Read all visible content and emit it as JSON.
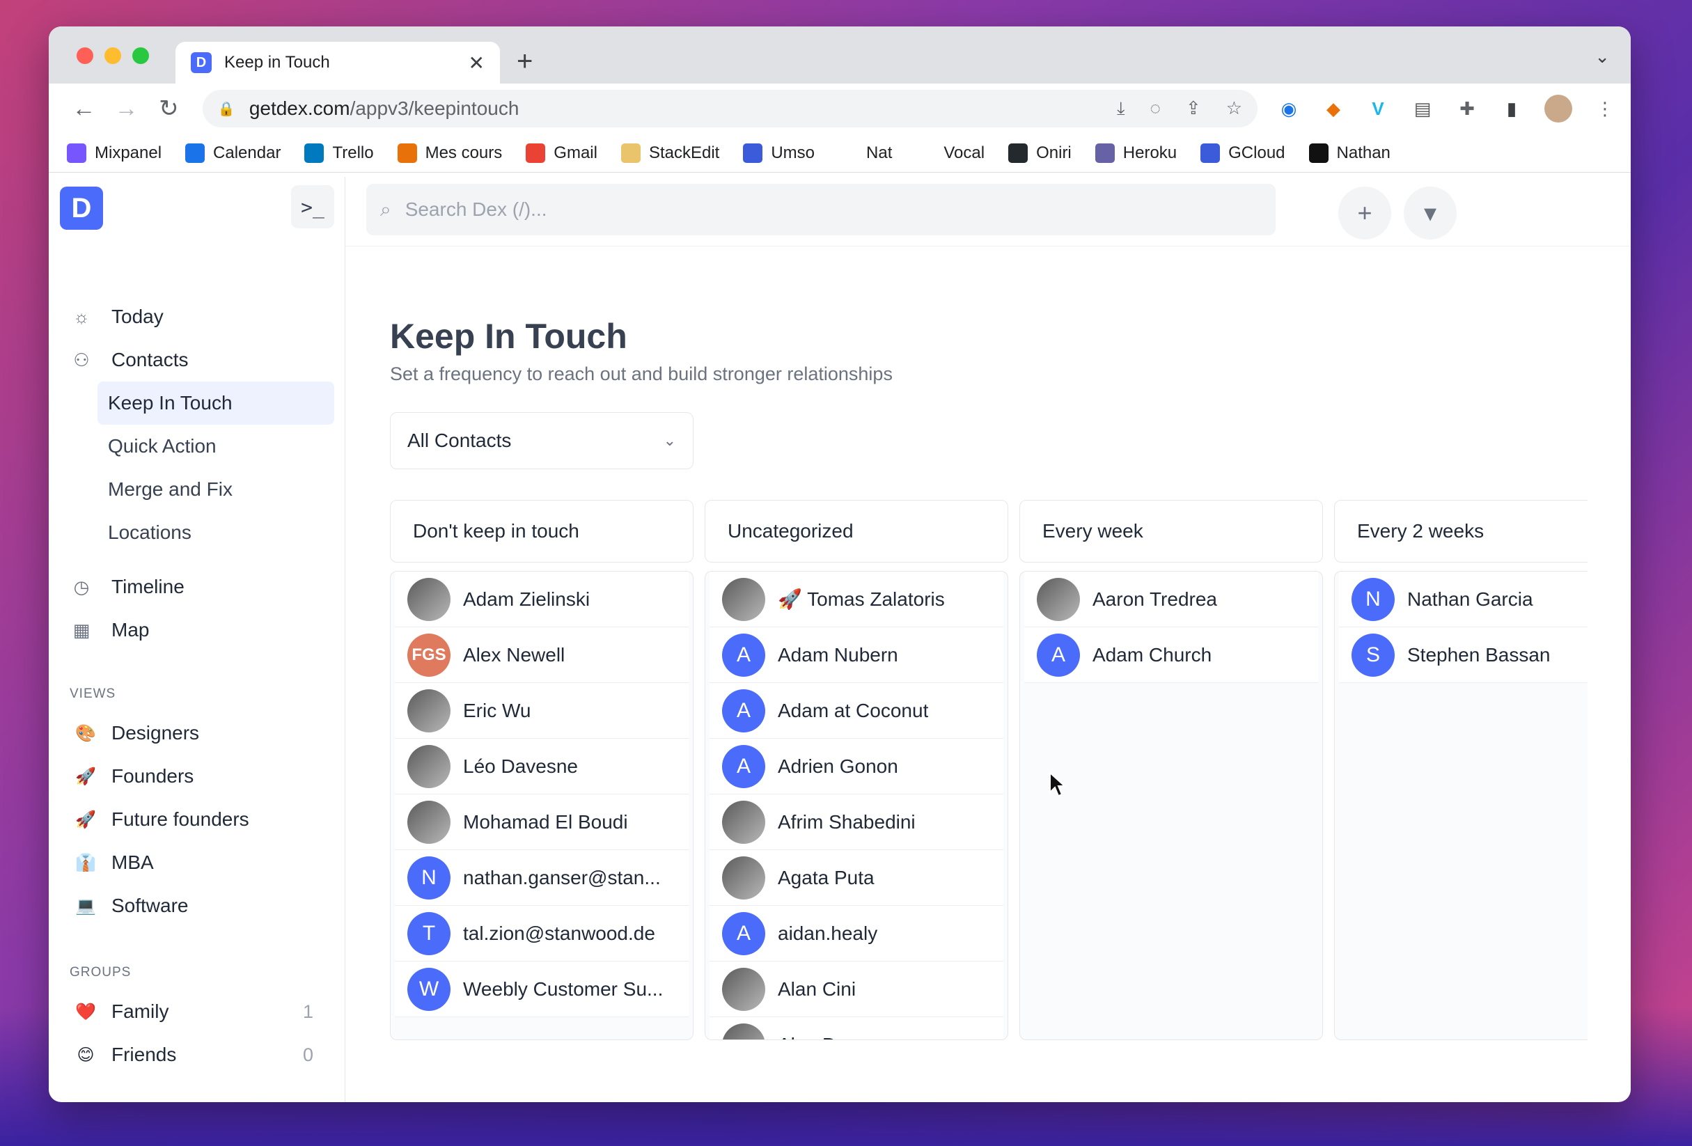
{
  "browser": {
    "tab_title": "Keep in Touch",
    "url_host": "getdex.com",
    "url_path": "/appv3/keepintouch",
    "bookmarks": [
      {
        "label": "Mixpanel",
        "color": "#7856ff"
      },
      {
        "label": "Calendar",
        "color": "#1a73e8"
      },
      {
        "label": "Trello",
        "color": "#0079bf"
      },
      {
        "label": "Mes cours",
        "color": "#e8710a"
      },
      {
        "label": "Gmail",
        "color": "#ea4335"
      },
      {
        "label": "StackEdit",
        "color": "#e9c46a"
      },
      {
        "label": "Umso",
        "color": "#3b5bdb"
      },
      {
        "label": "Nat",
        "color": "#ffffff"
      },
      {
        "label": "Vocal",
        "color": "#ffffff"
      },
      {
        "label": "Oniri",
        "color": "#24292e"
      },
      {
        "label": "Heroku",
        "color": "#6762a6"
      },
      {
        "label": "GCloud",
        "color": "#3b5bdb"
      },
      {
        "label": "Nathan",
        "color": "#111111"
      }
    ]
  },
  "sidebar": {
    "nav": {
      "today": "Today",
      "contacts": "Contacts",
      "keep_in_touch": "Keep In Touch",
      "quick_action": "Quick Action",
      "merge_and_fix": "Merge and Fix",
      "locations": "Locations",
      "timeline": "Timeline",
      "map": "Map"
    },
    "views_label": "VIEWS",
    "views": [
      {
        "emoji": "🎨",
        "label": "Designers"
      },
      {
        "emoji": "🚀",
        "label": "Founders"
      },
      {
        "emoji": "🚀",
        "label": "Future founders"
      },
      {
        "emoji": "👔",
        "label": "MBA"
      },
      {
        "emoji": "💻",
        "label": "Software"
      }
    ],
    "groups_label": "GROUPS",
    "groups": [
      {
        "emoji": "❤️",
        "label": "Family",
        "count": "1"
      },
      {
        "emoji": "😊",
        "label": "Friends",
        "count": "0"
      }
    ]
  },
  "search": {
    "placeholder": "Search Dex (/)..."
  },
  "page": {
    "title": "Keep In Touch",
    "subtitle": "Set a frequency to reach out and build stronger relationships",
    "filter_value": "All Contacts"
  },
  "columns": [
    {
      "title": "Don't keep in touch",
      "contacts": [
        {
          "name": "Adam Zielinski",
          "avatar": "photo",
          "initial": ""
        },
        {
          "name": "Alex Newell",
          "avatar": "fgs",
          "initial": "FGS"
        },
        {
          "name": "Eric Wu",
          "avatar": "photo",
          "initial": ""
        },
        {
          "name": "Léo Davesne",
          "avatar": "photo",
          "initial": ""
        },
        {
          "name": "Mohamad El Boudi",
          "avatar": "photo",
          "initial": ""
        },
        {
          "name": "nathan.ganser@stan...",
          "avatar": "letter",
          "initial": "N"
        },
        {
          "name": "tal.zion@stanwood.de",
          "avatar": "letter",
          "initial": "T"
        },
        {
          "name": "Weebly Customer Su...",
          "avatar": "letter",
          "initial": "W"
        }
      ]
    },
    {
      "title": "Uncategorized",
      "contacts": [
        {
          "name": "🚀 Tomas Zalatoris",
          "avatar": "photo",
          "initial": ""
        },
        {
          "name": "Adam Nubern",
          "avatar": "letter",
          "initial": "A"
        },
        {
          "name": "Adam at Coconut",
          "avatar": "letter",
          "initial": "A"
        },
        {
          "name": "Adrien Gonon",
          "avatar": "letter",
          "initial": "A"
        },
        {
          "name": "Afrim Shabedini",
          "avatar": "photo",
          "initial": ""
        },
        {
          "name": "Agata Puta",
          "avatar": "photo",
          "initial": ""
        },
        {
          "name": "aidan.healy",
          "avatar": "letter",
          "initial": "A"
        },
        {
          "name": "Alan Cini",
          "avatar": "photo",
          "initial": ""
        },
        {
          "name": "Alan Donegan",
          "avatar": "photo",
          "initial": ""
        }
      ]
    },
    {
      "title": "Every week",
      "contacts": [
        {
          "name": "Aaron Tredrea",
          "avatar": "photo",
          "initial": ""
        },
        {
          "name": "Adam Church",
          "avatar": "letter",
          "initial": "A"
        }
      ]
    },
    {
      "title": "Every 2 weeks",
      "contacts": [
        {
          "name": "Nathan Garcia",
          "avatar": "letter",
          "initial": "N"
        },
        {
          "name": "Stephen Bassan",
          "avatar": "letter",
          "initial": "S"
        }
      ]
    }
  ]
}
